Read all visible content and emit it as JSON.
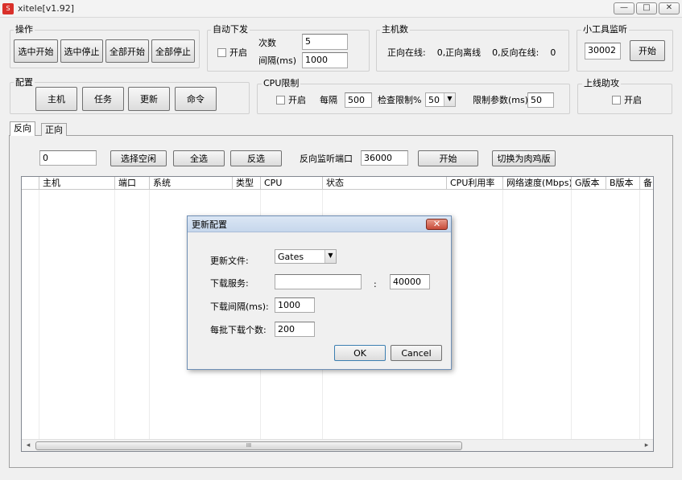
{
  "window": {
    "title": "xitele[v1.92]",
    "icon_text": "S",
    "min_glyph": "—",
    "max_glyph": "□",
    "close_glyph": "✕"
  },
  "ops": {
    "label": "操作",
    "buttons": [
      "选中开始",
      "选中停止",
      "全部开始",
      "全部停止"
    ]
  },
  "auto_dispatch": {
    "label": "自动下发",
    "enable_label": "开启",
    "count_label": "次数",
    "count_value": "5",
    "interval_label": "间隔(ms)",
    "interval_value": "1000"
  },
  "hosts": {
    "label": "主机数",
    "text": "正向在线:    0,正向离线    0,反向在线:    0"
  },
  "tool_listen": {
    "label": "小工具监听",
    "port_value": "30002",
    "start_label": "开始"
  },
  "config": {
    "label": "配置",
    "buttons": [
      "主机",
      "任务",
      "更新",
      "命令"
    ]
  },
  "cpu_limit": {
    "label": "CPU限制",
    "enable_label": "开启",
    "interval_label": "每隔",
    "interval_value": "500",
    "check_label": "检查限制%",
    "check_value": "50",
    "param_label": "限制参数(ms)",
    "param_value": "50"
  },
  "online_assist": {
    "label": "上线助攻",
    "enable_label": "开启"
  },
  "tabs": [
    "反向",
    "正向"
  ],
  "toolbar": {
    "filter_value": "0",
    "select_idle": "选择空闲",
    "select_all": "全选",
    "invert": "反选",
    "port_label": "反向监听端口",
    "port_value": "36000",
    "start": "开始",
    "switch": "切换为肉鸡版"
  },
  "grid": {
    "columns": [
      "主机",
      "端口",
      "系统",
      "类型",
      "CPU",
      "状态",
      "CPU利用率",
      "网络速度(Mbps)",
      "G版本",
      "B版本",
      "备"
    ],
    "scroll_grip": "III",
    "left_arrow": "◂",
    "right_arrow": "▸"
  },
  "dialog": {
    "title": "更新配置",
    "close_glyph": "✕",
    "file_label": "更新文件:",
    "file_value": "Gates",
    "server_label": "下载服务:",
    "server_value": "",
    "colon": ":",
    "server_port": "40000",
    "interval_label": "下载间隔(ms):",
    "interval_value": "1000",
    "batch_label": "每批下载个数:",
    "batch_value": "200",
    "ok": "OK",
    "cancel": "Cancel"
  }
}
